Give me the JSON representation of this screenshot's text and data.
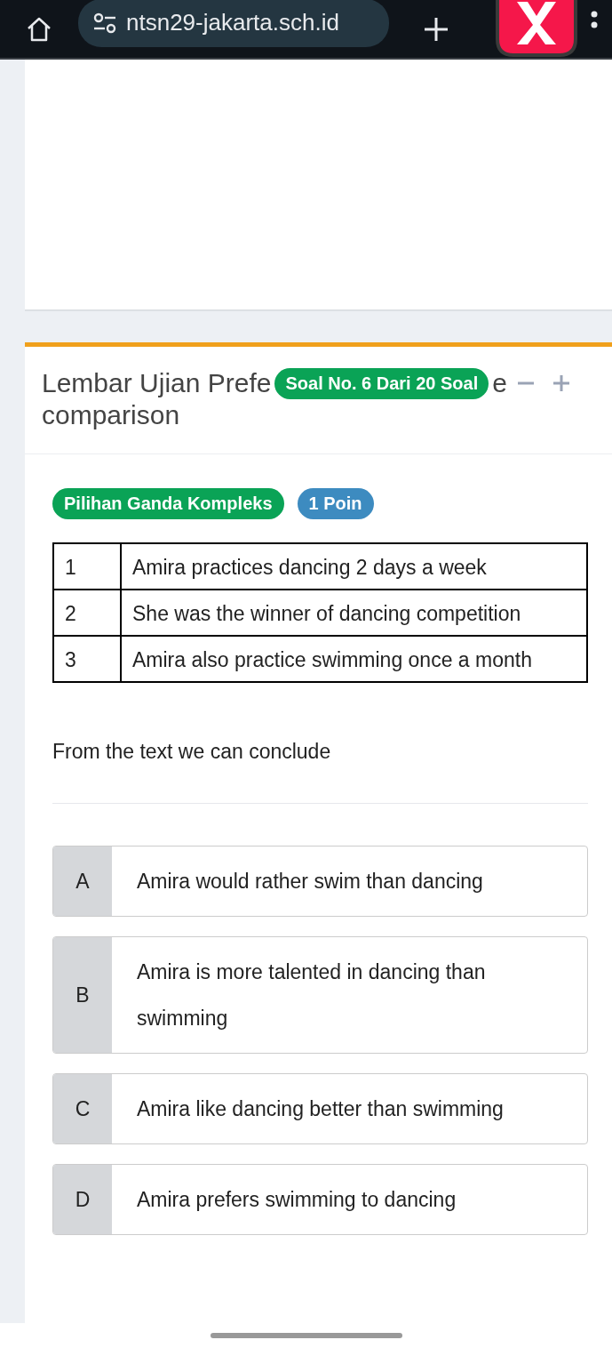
{
  "browser": {
    "url": "ntsn29-jakarta.sch.id"
  },
  "exam": {
    "title_start": "Lembar Ujian Prefe",
    "counter": "Soal No. 6 Dari 20 Soal",
    "title_tail": "e",
    "title_line2": "comparison"
  },
  "question": {
    "type_badge": "Pilihan Ganda Kompleks",
    "points_badge": "1 Poin",
    "table": [
      {
        "number": "1",
        "text": "Amira practices dancing 2 days a week"
      },
      {
        "number": "2",
        "text": "She was the winner of dancing competition"
      },
      {
        "number": "3",
        "text": "Amira also practice swimming once a month"
      }
    ],
    "prompt": "From the text we can conclude",
    "options": [
      {
        "letter": "A",
        "text": "Amira would rather swim than dancing",
        "selected": false
      },
      {
        "letter": "B",
        "text": "Amira is more talented in dancing than swimming",
        "selected": false
      },
      {
        "letter": "C",
        "text": "Amira like dancing better than swimming",
        "selected": false
      },
      {
        "letter": "D",
        "text": "Amira prefers swimming to dancing",
        "selected": false
      }
    ]
  }
}
